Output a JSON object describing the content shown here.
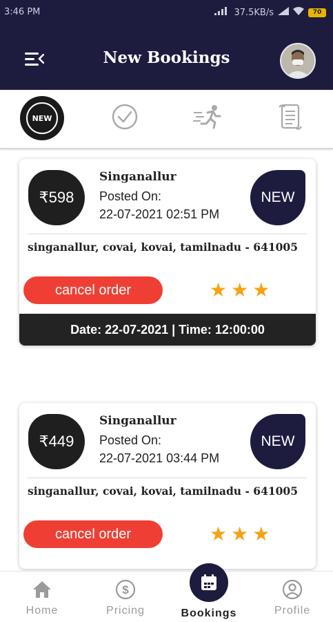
{
  "status_bar": {
    "time": "3:46 PM",
    "network_speed": "37.5KB/s",
    "battery": "70"
  },
  "header": {
    "title": "New Bookings"
  },
  "tabs": [
    {
      "id": "new",
      "label": "NEW",
      "icon": "new-badge-icon",
      "active": true
    },
    {
      "id": "completed",
      "icon": "check-circle-icon",
      "active": false
    },
    {
      "id": "in-progress",
      "icon": "running-person-icon",
      "active": false
    },
    {
      "id": "history",
      "icon": "scroll-icon",
      "active": false
    }
  ],
  "bookings": [
    {
      "price": "₹598",
      "title": "Singanallur",
      "posted_label": "Posted On:",
      "posted_datetime": "22-07-2021 02:51 PM",
      "status": "NEW",
      "address": "singanallur, covai, kovai, tamilnadu - 641005",
      "cancel_label": "cancel order",
      "rating": 3,
      "footer": "Date: 22-07-2021 |  Time: 12:00:00"
    },
    {
      "price": "₹449",
      "title": "Singanallur",
      "posted_label": "Posted On:",
      "posted_datetime": "22-07-2021 03:44 PM",
      "status": "NEW",
      "address": "singanallur, covai, kovai, tamilnadu - 641005",
      "cancel_label": "cancel order",
      "rating": 3
    }
  ],
  "bottom_nav": {
    "items": [
      {
        "label": "Home",
        "icon": "home-icon",
        "active": false
      },
      {
        "label": "Pricing",
        "icon": "dollar-circle-icon",
        "active": false
      },
      {
        "label": "Bookings",
        "icon": "calendar-icon",
        "active": true
      },
      {
        "label": "Profile",
        "icon": "user-circle-icon",
        "active": false
      }
    ]
  },
  "colors": {
    "primary": "#1d1b3e",
    "cancel": "#ef3f35",
    "star": "#f5a313",
    "badge": "#1f1f1f"
  }
}
